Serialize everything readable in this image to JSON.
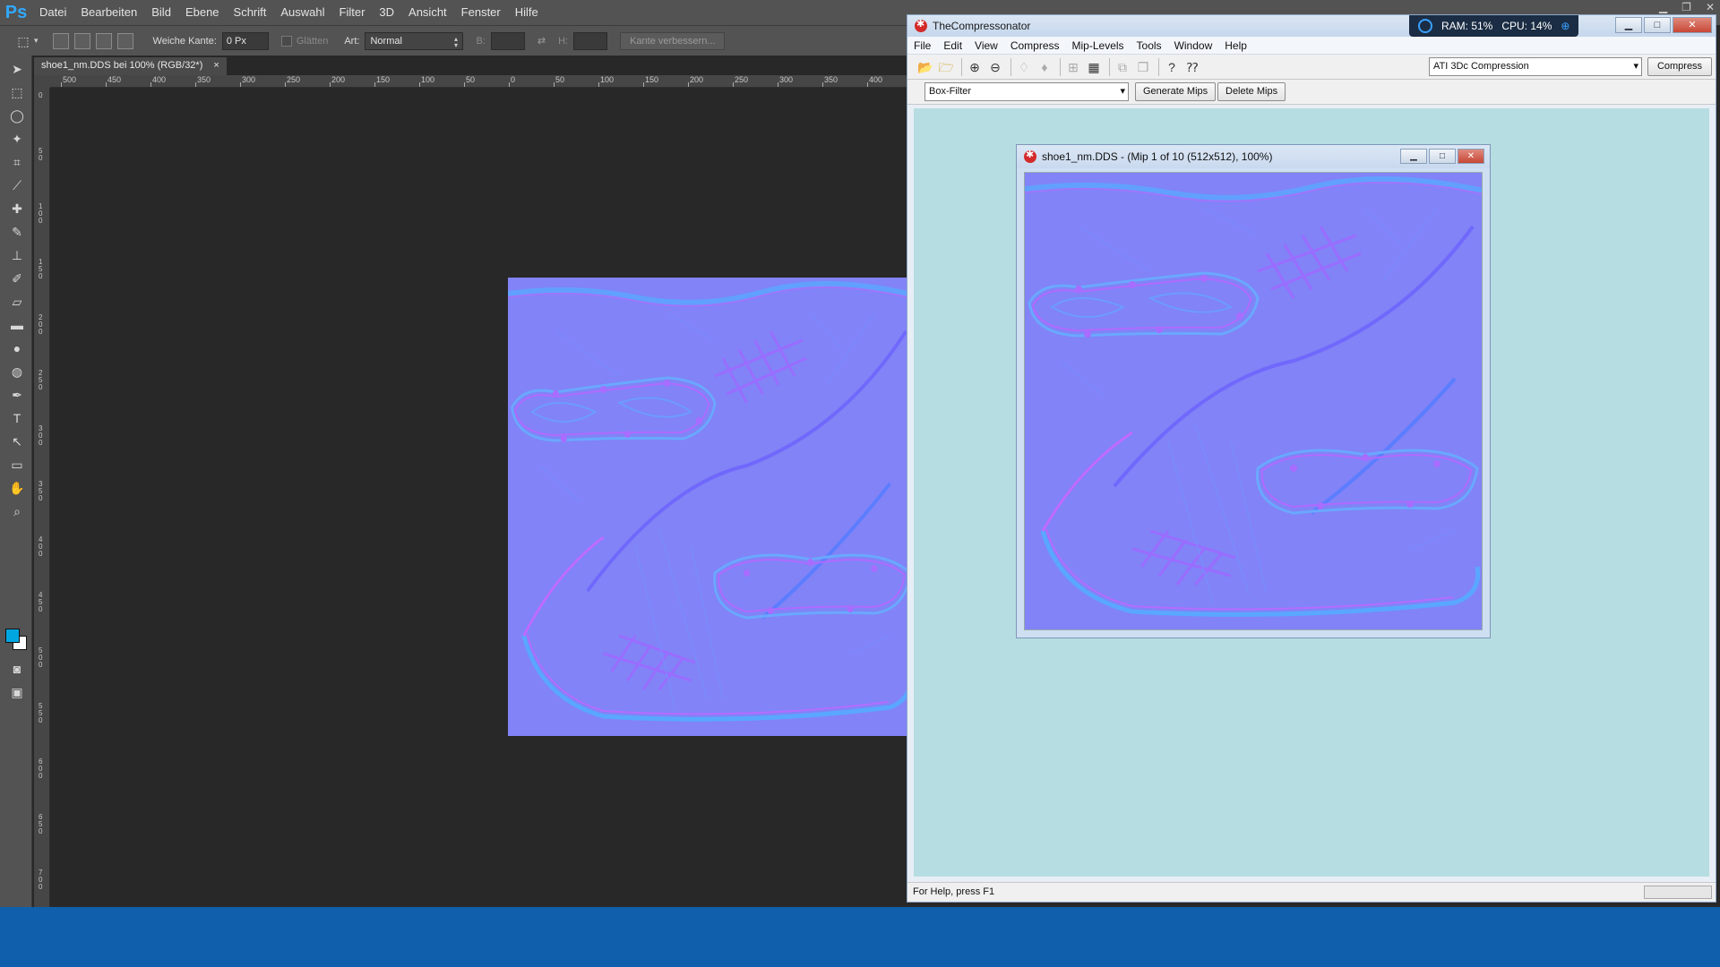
{
  "photoshop": {
    "logo": "Ps",
    "menu": [
      "Datei",
      "Bearbeiten",
      "Bild",
      "Ebene",
      "Schrift",
      "Auswahl",
      "Filter",
      "3D",
      "Ansicht",
      "Fenster",
      "Hilfe"
    ],
    "options": {
      "feather_label": "Weiche Kante:",
      "feather_value": "0 Px",
      "antialias_label": "Glätten",
      "style_label": "Art:",
      "style_value": "Normal",
      "width_label": "B:",
      "height_label": "H:",
      "refine_edge": "Kante verbessern..."
    },
    "document_tab": "shoe1_nm.DDS bei 100% (RGB/32*)",
    "tab_close": "×",
    "ruler_h": [
      "500",
      "450",
      "400",
      "350",
      "300",
      "250",
      "200",
      "150",
      "100",
      "50",
      "0",
      "50",
      "100",
      "150",
      "200",
      "250",
      "300",
      "350",
      "400"
    ],
    "ruler_v": [
      "0",
      "5 0",
      "1 0 0",
      "1 5 0",
      "2 0 0",
      "2 5 0",
      "3 0 0",
      "3 5 0",
      "4 0 0",
      "4 5 0",
      "5 0 0",
      "5 5 0",
      "6 0 0",
      "6 5 0",
      "7 0 0"
    ],
    "swatch_foreground": "#00a6e0",
    "swatch_background": "#ffffff"
  },
  "compressonator": {
    "title": "TheCompressonator",
    "stats": {
      "ram": "RAM: 51%",
      "cpu": "CPU: 14%"
    },
    "menu": [
      "File",
      "Edit",
      "View",
      "Compress",
      "Mip-Levels",
      "Tools",
      "Window",
      "Help"
    ],
    "compression_format": "ATI 3Dc Compression",
    "compress_button": "Compress",
    "filter": "Box-Filter",
    "generate_mips": "Generate Mips",
    "delete_mips": "Delete Mips",
    "child_window_title": "shoe1_nm.DDS - (Mip 1 of 10 (512x512), 100%)",
    "status": "For Help, press F1"
  },
  "colors": {
    "taskbar": "#0f5fad",
    "normal_map_base": "#8080ff",
    "mdi_background": "#b6dde2"
  }
}
